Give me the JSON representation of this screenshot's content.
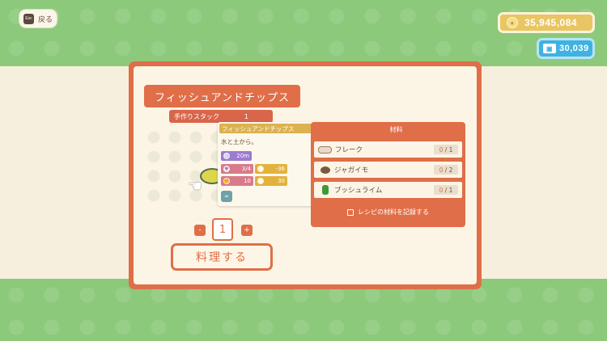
{
  "nav": {
    "back_key": "Esc",
    "back_label": "戻る"
  },
  "currency": {
    "bells": "35,945,084",
    "bell_icon": "coin-icon",
    "miles": "30,039",
    "miles_icon": "ticket-icon"
  },
  "recipe": {
    "title": "フィッシュアンドチップス",
    "stack_label": "手作りスタック",
    "stack_value": "1",
    "popup": {
      "name": "フィッシュアンドチップス",
      "description": "水と土から。",
      "time": "20m",
      "hp": "3/4",
      "sp": "-36",
      "attack": "10",
      "armor": "30"
    }
  },
  "materials": {
    "header": "材料",
    "items": [
      {
        "name": "フレーク",
        "have": "0",
        "need": "/ 1",
        "icon": "flake-icon"
      },
      {
        "name": "ジャガイモ",
        "have": "0",
        "need": "/ 2",
        "icon": "potato-icon"
      },
      {
        "name": "ブッシュライム",
        "have": "0",
        "need": "/ 1",
        "icon": "lime-icon"
      }
    ],
    "record_label": "レシピの材料を記録する"
  },
  "quantity": {
    "minus": "-",
    "value": "1",
    "plus": "+"
  },
  "cook_label": "料理する"
}
